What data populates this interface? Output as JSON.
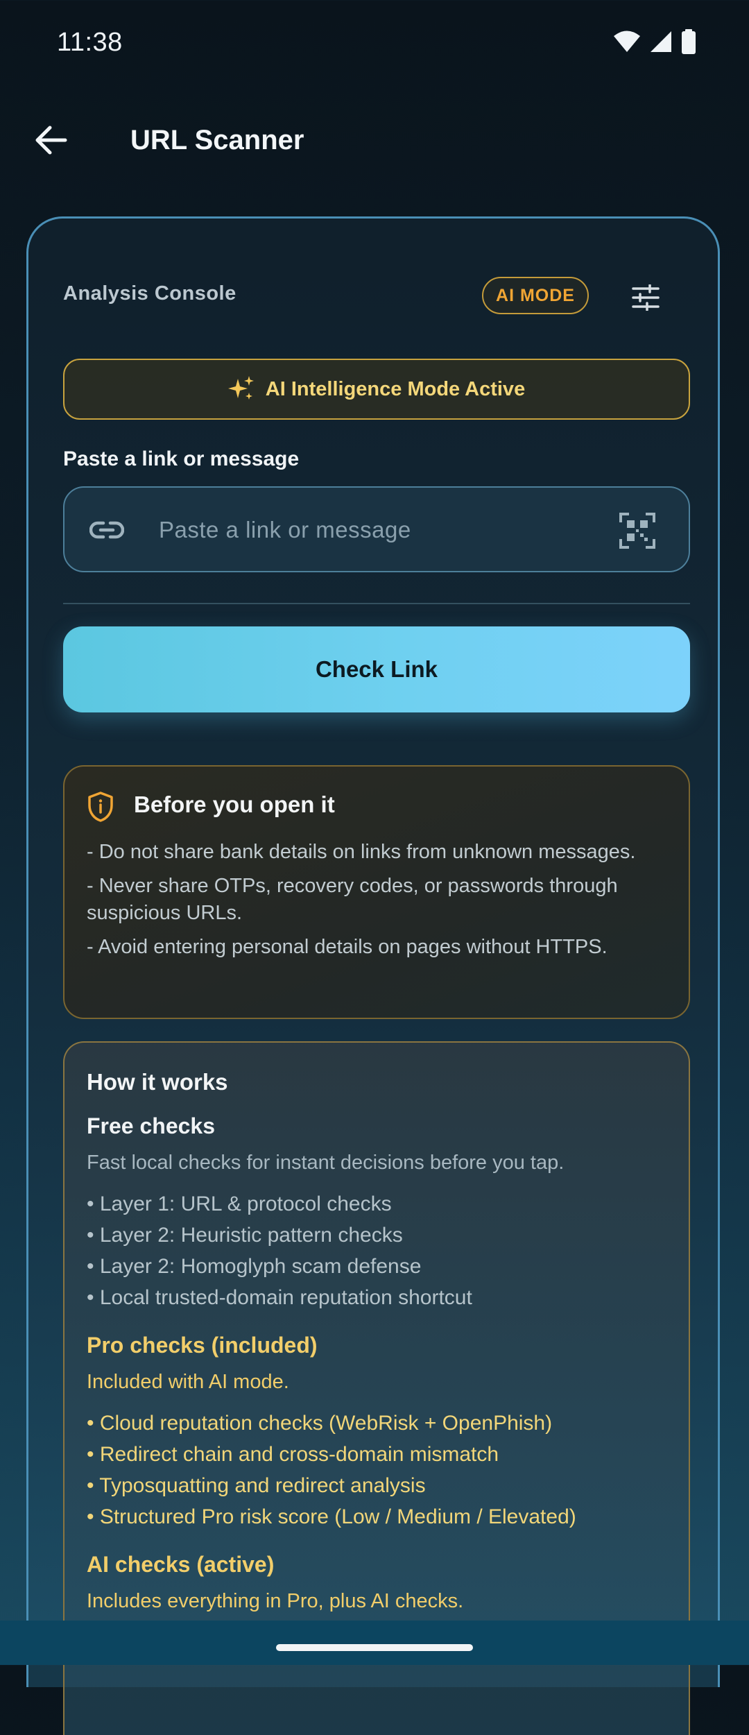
{
  "status_bar": {
    "time": "11:38"
  },
  "app_bar": {
    "title": "URL Scanner"
  },
  "console": {
    "label": "Analysis Console",
    "ai_mode_badge": "AI MODE",
    "ai_banner": "AI Intelligence Mode Active",
    "input_label": "Paste a link or message",
    "input_placeholder": "Paste a link or message",
    "input_value": "",
    "check_button": "Check Link"
  },
  "warning": {
    "title": "Before you open it",
    "items": [
      "- Do not share bank details on links from unknown messages.",
      "- Never share OTPs, recovery codes, or passwords through suspicious URLs.",
      "- Avoid entering personal details on pages without HTTPS."
    ]
  },
  "how_it_works": {
    "title": "How it works",
    "free": {
      "title": "Free checks",
      "desc": "Fast local checks for instant decisions before you tap.",
      "items": [
        "• Layer 1: URL & protocol checks",
        "• Layer 2: Heuristic pattern checks",
        "• Layer 2: Homoglyph scam defense",
        "• Local trusted-domain reputation shortcut"
      ]
    },
    "pro": {
      "title": "Pro checks (included)",
      "desc": "Included with AI mode.",
      "items": [
        "• Cloud reputation checks (WebRisk + OpenPhish)",
        "• Redirect chain and cross-domain mismatch",
        "• Typosquatting and redirect analysis",
        "• Structured Pro risk score (Low / Medium / Elevated)"
      ]
    },
    "ai": {
      "title": "AI checks (active)",
      "desc": "Includes everything in Pro, plus AI checks."
    }
  },
  "colors": {
    "accent_cyan": "#6fd0f0",
    "gold": "#f2ce6a",
    "badge_orange": "#f0a534"
  },
  "icons": {
    "back": "arrow-left-icon",
    "tune": "tune-sliders-icon",
    "sparkle": "sparkle-icon",
    "link": "link-icon",
    "qr": "qr-scan-icon",
    "shield": "shield-info-icon"
  }
}
